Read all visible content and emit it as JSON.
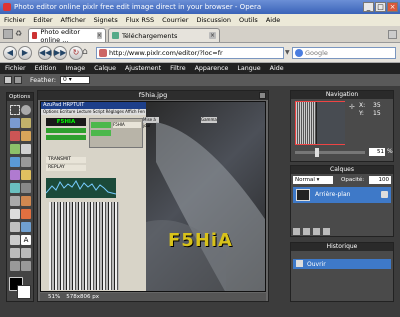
{
  "window": {
    "title": "Photo editor online pixlr free edit image direct in your browser - Opera"
  },
  "browser_menu": [
    "Fichier",
    "Editer",
    "Afficher",
    "Signets",
    "Flux RSS",
    "Courrier",
    "Discussion",
    "Outils",
    "Aide"
  ],
  "tabs": [
    {
      "label": "Photo editor online ..."
    },
    {
      "label": "Téléchargements"
    }
  ],
  "address": {
    "url": "http://www.pixlr.com/editor/?loc=fr"
  },
  "search": {
    "placeholder": "Google"
  },
  "app_menu": [
    "Fichier",
    "Edition",
    "Image",
    "Calque",
    "Ajustement",
    "Filtre",
    "Apparence",
    "Langue",
    "Aide"
  ],
  "options": {
    "feather_label": "Feather:",
    "feather_value": "0"
  },
  "tools_panel": {
    "title": "Options"
  },
  "canvas": {
    "title": "f5hia.jpg",
    "zoom": "51%",
    "size": "578x806 px",
    "watermark": "F5HiA"
  },
  "screen_in_image": {
    "title": "AzuPad HRPTUIT",
    "menu": "Options  Ecriture  Lecture  Script  Réglages  Affich  Fen",
    "callsign": "F5HIA",
    "label1": "F5HIA",
    "label2": "TRANSMIT",
    "label3": "REPLAY",
    "controls": [
      "Mise à jour",
      "Gamma"
    ]
  },
  "navigation": {
    "title": "Navigation",
    "x_label": "X:",
    "x_value": "35",
    "y_label": "Y:",
    "y_value": "15",
    "zoom": "51",
    "zoom_unit": "%"
  },
  "layers": {
    "title": "Calques",
    "mode": "Normal",
    "opacity_label": "Opacité:",
    "opacity_value": "100",
    "layer_name": "Arrière-plan"
  },
  "history": {
    "title": "Historique",
    "item": "Ouvrir"
  },
  "colors": {
    "accent": "#3e79c8",
    "titlebar": "#3a63b8",
    "app_bg": "#3c3c3c"
  }
}
